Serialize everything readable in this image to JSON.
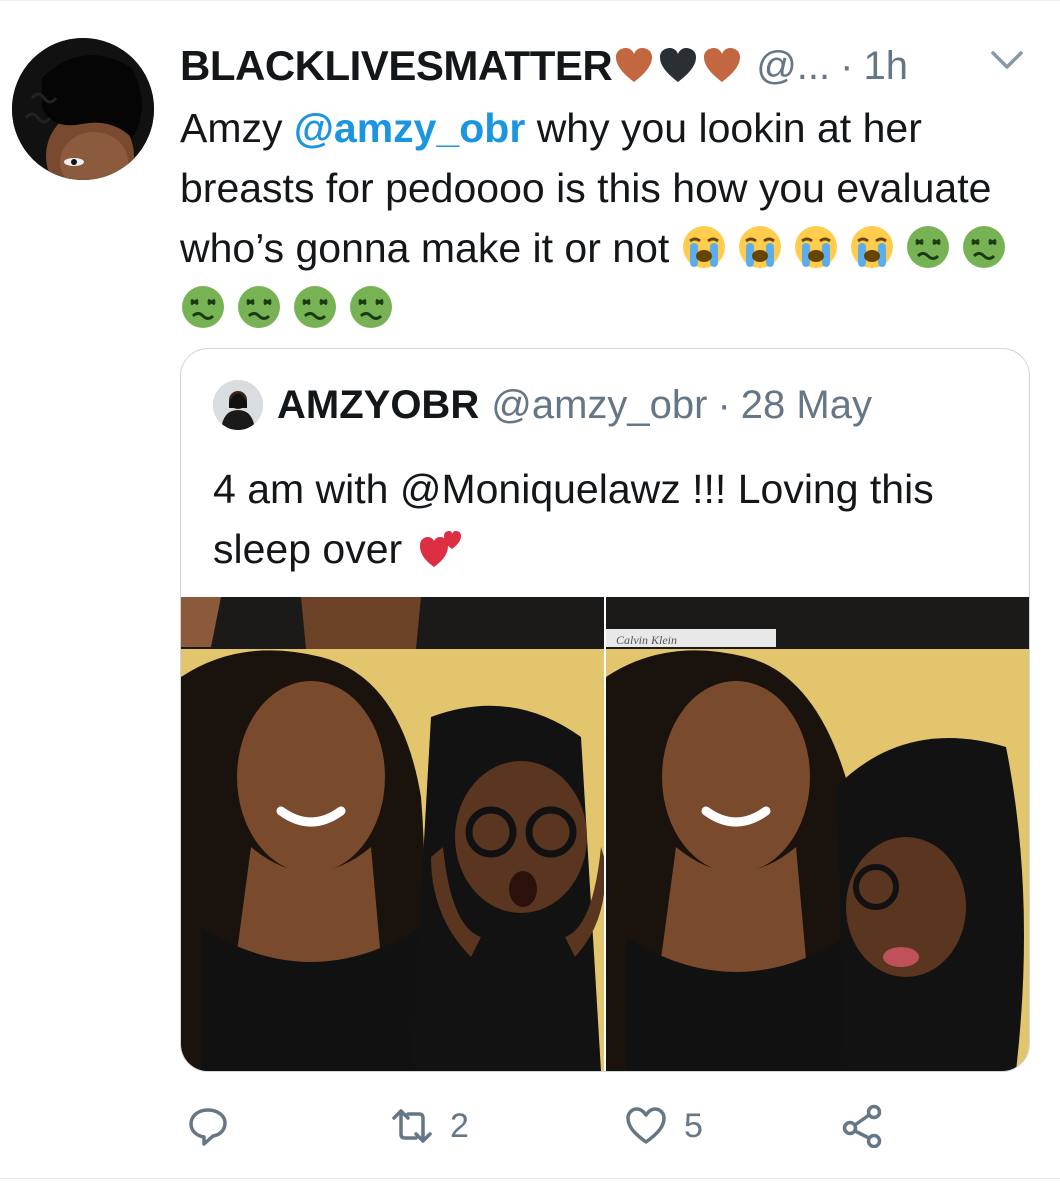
{
  "tweet": {
    "display_name": "BLACKLIVESMATTER",
    "name_emoji": [
      "orange-heart-icon",
      "black-heart-icon",
      "orange-heart-icon"
    ],
    "handle": "@...",
    "separator": "·",
    "time": "1h",
    "text": {
      "prefix": "Amzy ",
      "mention": "@amzy_obr",
      "body": " why you lookin at her breasts for pedoooo is this how you evaluate who’s gonna make it or not",
      "emoji": [
        "loudly-crying-face-icon",
        "loudly-crying-face-icon",
        "loudly-crying-face-icon",
        "loudly-crying-face-icon",
        "nauseated-face-icon",
        "nauseated-face-icon",
        "nauseated-face-icon",
        "nauseated-face-icon",
        "nauseated-face-icon",
        "nauseated-face-icon"
      ]
    }
  },
  "quoted": {
    "display_name": "AMZYOBR",
    "handle": "@amzy_obr",
    "separator": "·",
    "date": "28 May",
    "text": "4 am with @Moniquelawz !!! Loving this sleep over",
    "text_emoji": "two-hearts-icon",
    "photo_text": [
      "Calvin Klein"
    ]
  },
  "actions": {
    "reply_count": "",
    "retweet_count": "2",
    "like_count": "5"
  },
  "colors": {
    "text": "#14171a",
    "secondary": "#657786",
    "link": "#1b95e0",
    "border": "#ccd6dd"
  }
}
